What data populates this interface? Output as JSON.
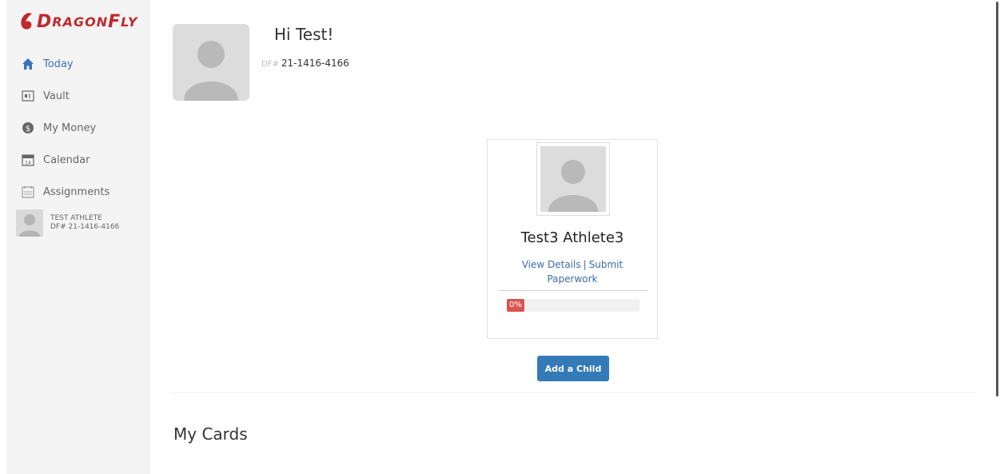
{
  "brand": {
    "logo_text_first": "D",
    "logo_text_rest": "RAGON",
    "logo_text_end": "F",
    "logo_text_end_rest": "LY",
    "color": "#c0282d"
  },
  "sidebar": {
    "items": [
      {
        "label": "Today",
        "icon": "home-icon",
        "active": true
      },
      {
        "label": "Vault",
        "icon": "vault-icon"
      },
      {
        "label": "My Money",
        "icon": "money-icon"
      },
      {
        "label": "Calendar",
        "icon": "calendar-icon"
      },
      {
        "label": "Assignments",
        "icon": "assignments-icon"
      }
    ],
    "user": {
      "name": "TEST ATHLETE",
      "df_prefix": "DF#",
      "df_number": "21-1416-4166"
    }
  },
  "header": {
    "greeting": "Hi Test!",
    "df_prefix": "DF#",
    "df_number": "21-1416-4166"
  },
  "child_card": {
    "name": "Test3 Athlete3",
    "view_details": "View Details",
    "separator": "|",
    "submit_paperwork": "Submit Paperwork",
    "progress_label": "0%",
    "progress_value": 0
  },
  "add_child_label": "Add a Child",
  "my_cards_heading": "My Cards",
  "colors": {
    "accent": "#337ab7",
    "link": "#3a6ea5",
    "danger": "#d9534f"
  }
}
